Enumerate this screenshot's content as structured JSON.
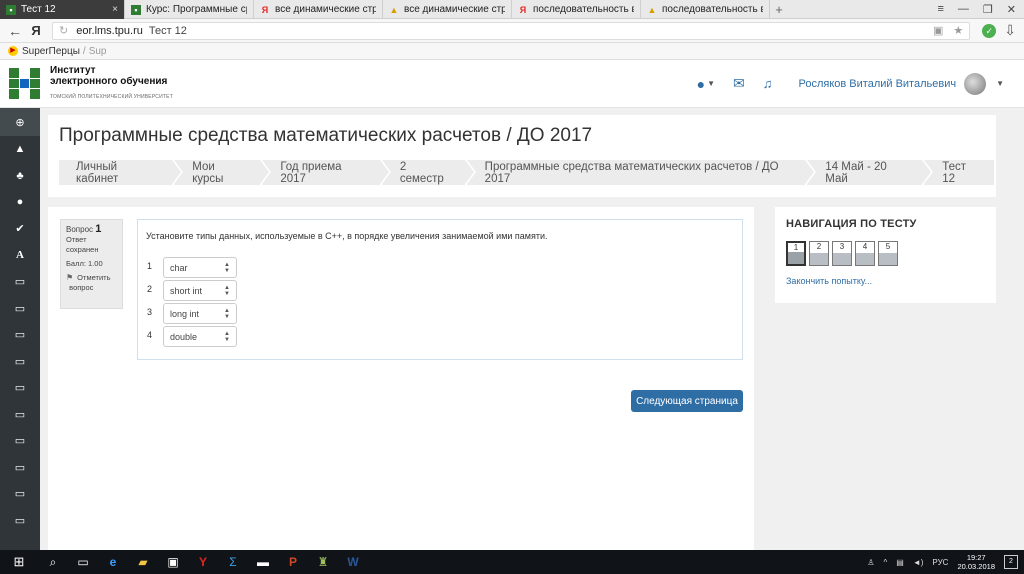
{
  "browser": {
    "tabs": [
      {
        "label": "Тест 12",
        "icon": "moodle-favicon",
        "active": true
      },
      {
        "label": "Курс: Программные средст",
        "icon": "moodle-favicon",
        "active": false
      },
      {
        "label": "все динамические структур",
        "icon": "yandex-favicon",
        "active": false
      },
      {
        "label": "все динамические структур",
        "icon": "hat-favicon",
        "active": false
      },
      {
        "label": "последовательность выпол",
        "icon": "yandex-favicon",
        "active": false
      },
      {
        "label": "последовательность выпол",
        "icon": "hat-favicon",
        "active": false
      }
    ],
    "address": {
      "host": "eor.lms.tpu.ru",
      "title": "Тест 12"
    },
    "bookmark": {
      "label": "SuperПерцы",
      "sub": "Sup"
    }
  },
  "header": {
    "logo": {
      "line1": "Институт",
      "line2": "электронного обучения",
      "line3": "ТОМСКИЙ ПОЛИТЕХНИЧЕСКИЙ УНИВЕРСИТЕТ"
    },
    "user_name": "Росляков Виталий Витальевич"
  },
  "page": {
    "title": "Программные средства математических расчетов / ДО 2017",
    "breadcrumbs": [
      "Личный кабинет",
      "Мои курсы",
      "Год приема 2017",
      "2 семестр",
      "Программные средства математических расчетов / ДО 2017",
      "14 Май - 20 Май",
      "Тест 12"
    ]
  },
  "question": {
    "label": "Вопрос",
    "number": "1",
    "status_line1": "Ответ",
    "status_line2": "сохранен",
    "score": "Балл: 1.00",
    "flag_line1": "Отметить",
    "flag_line2": "вопрос",
    "text": "Установите типы данных, используемые в С++, в порядке увеличения занимаемой ими памяти.",
    "rows": [
      {
        "num": "1",
        "value": "char"
      },
      {
        "num": "2",
        "value": "short int"
      },
      {
        "num": "3",
        "value": "long int"
      },
      {
        "num": "4",
        "value": "double"
      }
    ],
    "next_label": "Следующая страница"
  },
  "quiz_nav": {
    "title": "НАВИГАЦИЯ ПО ТЕСТУ",
    "pages": [
      "1",
      "2",
      "3",
      "4",
      "5"
    ],
    "current": "1",
    "finish_label": "Закончить попытку..."
  },
  "taskbar": {
    "lang": "РУС",
    "time": "19:27",
    "date": "20.03.2018",
    "notifications": "2"
  }
}
